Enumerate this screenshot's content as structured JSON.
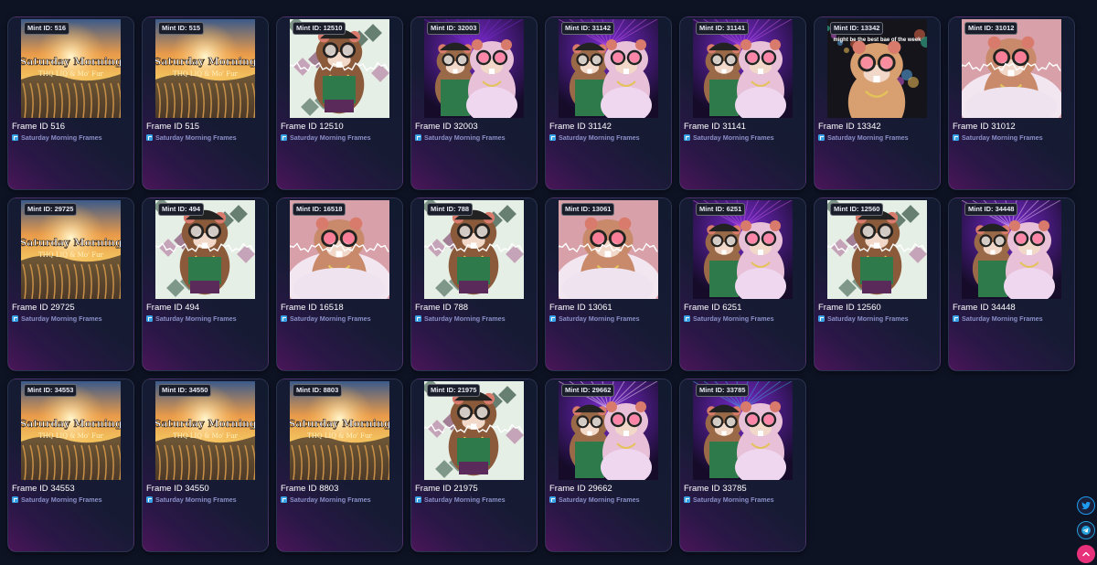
{
  "gallery": {
    "collection_name": "Saturday Morning Frames",
    "mint_prefix": "Mint ID: ",
    "title_prefix": "Frame ID ",
    "items": [
      {
        "id": "516",
        "art": "sunrise"
      },
      {
        "id": "515",
        "art": "sunrise"
      },
      {
        "id": "12510",
        "art": "glitch"
      },
      {
        "id": "32003",
        "art": "duo-dark"
      },
      {
        "id": "31142",
        "art": "duo-purple"
      },
      {
        "id": "31141",
        "art": "duo-purple"
      },
      {
        "id": "13342",
        "art": "bokeh",
        "caption": "might be the best bae of the week"
      },
      {
        "id": "31012",
        "art": "fur"
      },
      {
        "id": "29725",
        "art": "sunrise"
      },
      {
        "id": "494",
        "art": "glitch"
      },
      {
        "id": "16518",
        "art": "fur"
      },
      {
        "id": "788",
        "art": "glitch"
      },
      {
        "id": "13061",
        "art": "fur"
      },
      {
        "id": "6251",
        "art": "duo-purple"
      },
      {
        "id": "12560",
        "art": "glitch"
      },
      {
        "id": "34448",
        "art": "duo-beam"
      },
      {
        "id": "34553",
        "art": "sunrise"
      },
      {
        "id": "34550",
        "art": "sunrise"
      },
      {
        "id": "8803",
        "art": "sunrise"
      },
      {
        "id": "21975",
        "art": "glitch"
      },
      {
        "id": "29662",
        "art": "duo-pink"
      },
      {
        "id": "33785",
        "art": "duo-blue"
      }
    ]
  },
  "sunrise_art": {
    "line1": "Saturday Morning",
    "line2": "THQ LIQ & Mo' Fur"
  },
  "floating_buttons": {
    "twitter": "twitter-icon",
    "telegram": "telegram-icon",
    "scroll_top": "chevron-up-icon"
  },
  "colors": {
    "accent_pink": "#e8317b",
    "twitter_blue": "#1d9bf0",
    "collection_text": "#8a8fc8"
  }
}
